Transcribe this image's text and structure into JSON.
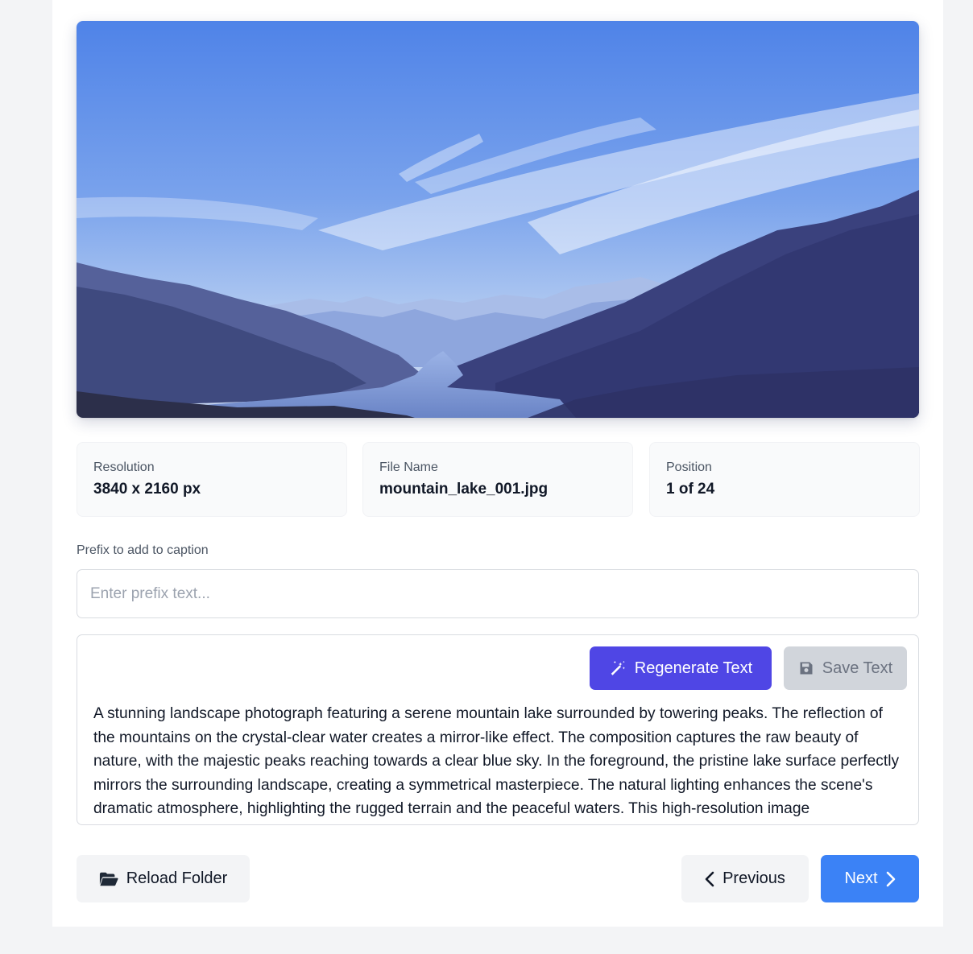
{
  "image": {
    "alt": "mountain lake landscape",
    "colors": {
      "sky_top": "#4a7fe6",
      "sky_bottom": "#a9c6f2",
      "mountain_dark": "#39407e",
      "water": "#6f8fd0"
    }
  },
  "info": {
    "resolution": {
      "label": "Resolution",
      "value": "3840 x 2160 px"
    },
    "file_name": {
      "label": "File Name",
      "value": "mountain_lake_001.jpg"
    },
    "position": {
      "label": "Position",
      "value": "1 of 24"
    }
  },
  "prefix": {
    "label": "Prefix to add to caption",
    "placeholder": "Enter prefix text...",
    "value": ""
  },
  "caption": {
    "regenerate_label": "Regenerate Text",
    "save_label": "Save Text",
    "text": "A stunning landscape photograph featuring a serene mountain lake surrounded by towering peaks. The reflection of the mountains on the crystal-clear water creates a mirror-like effect. The composition captures the raw beauty of nature, with the majestic peaks reaching towards a clear blue sky. In the foreground, the pristine lake surface perfectly mirrors the surrounding landscape, creating a symmetrical masterpiece. The natural lighting enhances the scene's dramatic atmosphere, highlighting the rugged terrain and the peaceful waters. This high-resolution image"
  },
  "footer": {
    "reload_label": "Reload Folder",
    "previous_label": "Previous",
    "next_label": "Next"
  },
  "colors": {
    "primary": "#4f46e5",
    "next": "#3b82f6",
    "disabled": "#d1d5db"
  },
  "icons": {
    "regenerate": "magic-wand-icon",
    "save": "floppy-disk-icon",
    "reload": "folder-open-icon",
    "previous": "chevron-left-icon",
    "next": "chevron-right-icon"
  }
}
